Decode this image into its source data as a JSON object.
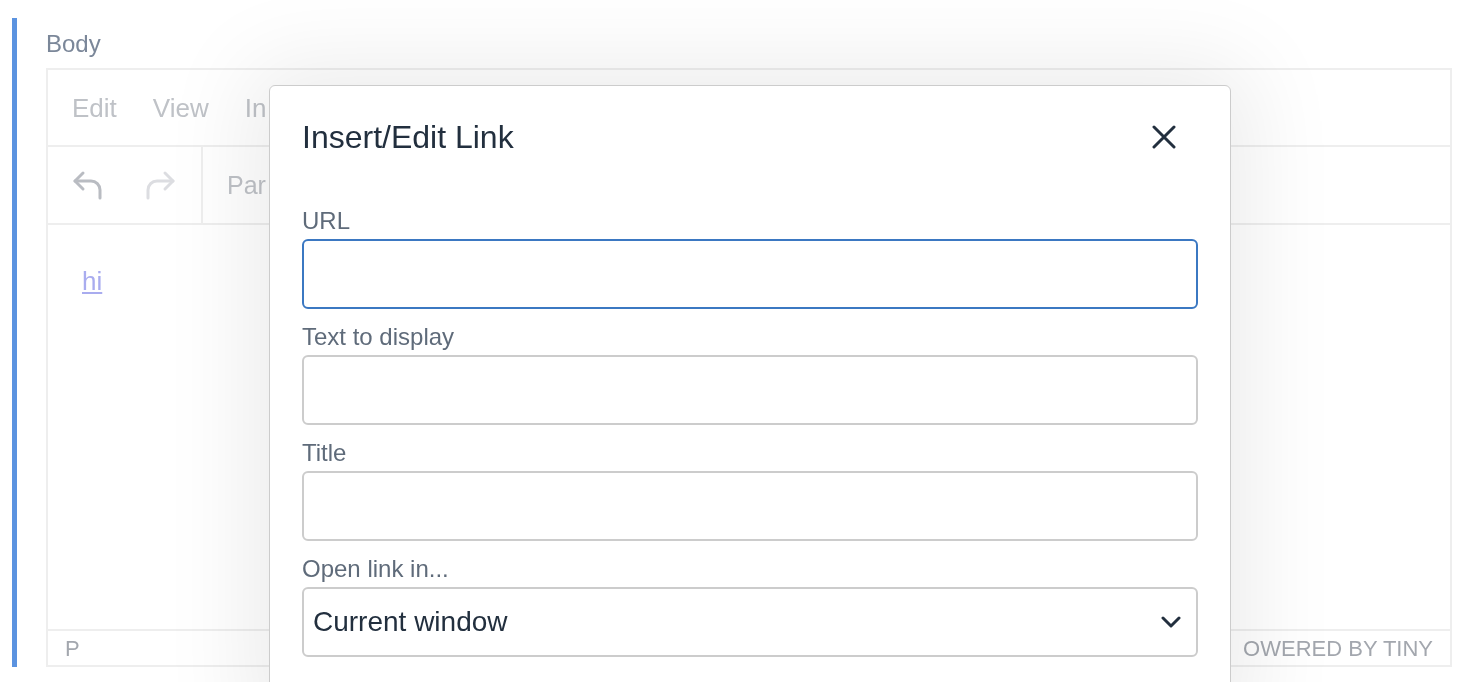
{
  "field_label": "Body",
  "editor": {
    "menubar": [
      {
        "label": "Edit"
      },
      {
        "label": "View"
      },
      {
        "label": "In"
      }
    ],
    "toolbar": [
      {
        "kind": "undo",
        "disabled": false
      },
      {
        "kind": "redo",
        "disabled": true
      }
    ],
    "format_select": "Par",
    "content": {
      "link_text": "hi"
    },
    "status_bar": {
      "path": "P",
      "branding": "OWERED BY TINY"
    }
  },
  "dialog": {
    "title": "Insert/Edit Link",
    "fields": [
      {
        "kind": "text",
        "label": "URL",
        "focused": true
      },
      {
        "kind": "text",
        "label": "Text to display",
        "focused": false
      },
      {
        "kind": "text",
        "label": "Title",
        "focused": false
      },
      {
        "kind": "select",
        "label": "Open link in...",
        "value": "Current window",
        "focused": false
      }
    ]
  }
}
